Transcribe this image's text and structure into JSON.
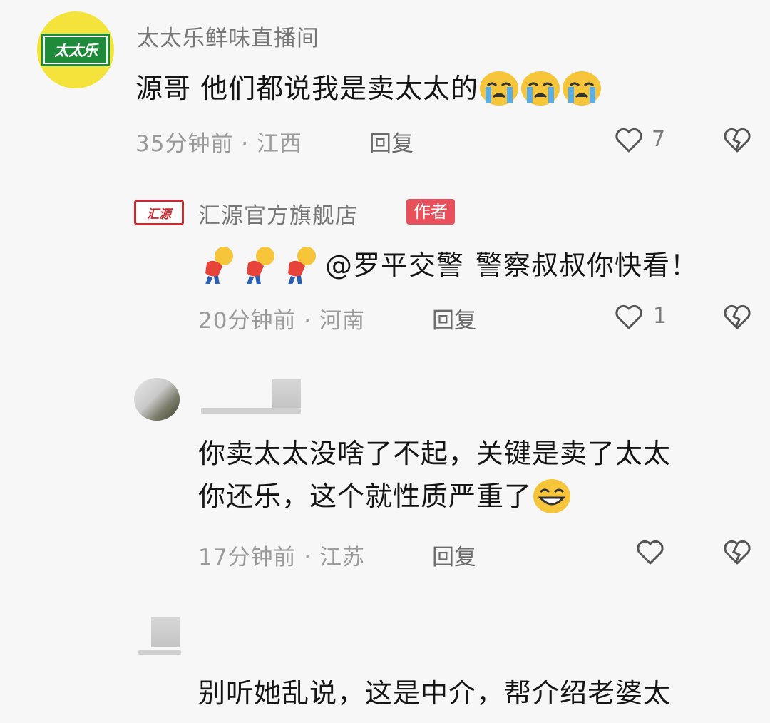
{
  "comments": [
    {
      "name": "太太乐鲜味直播间",
      "avatar_logo": "太太乐",
      "text": "源哥 他们都说我是卖太太的",
      "emojis": [
        "crying-face-icon",
        "crying-face-icon",
        "crying-face-icon"
      ],
      "time": "35分钟前",
      "region": "江西",
      "reply_label": "回复",
      "likes": "7"
    },
    {
      "name": "汇源官方旗舰店",
      "avatar_logo": "汇源",
      "badge": "作者",
      "mention": "@罗平交警",
      "text": "警察叔叔你快看！",
      "time": "20分钟前",
      "region": "河南",
      "reply_label": "回复",
      "likes": "1"
    },
    {
      "line1": "你卖太太没啥了不起，关键是卖了太太",
      "line2": "你还乐，这个就性质严重了",
      "time": "17分钟前",
      "region": "江苏",
      "reply_label": "回复"
    },
    {
      "line1": "别听她乱说，这是中介，帮介绍老婆太"
    }
  ],
  "colors": {
    "author_badge": "#e8505b",
    "brand_green": "#1f8a39",
    "brand_yellow": "#f3e33a"
  }
}
